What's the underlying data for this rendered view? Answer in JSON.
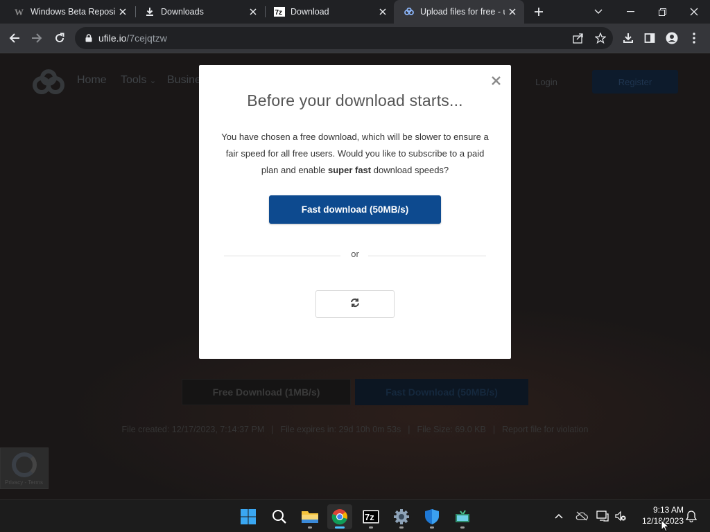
{
  "browser": {
    "tabs": [
      {
        "title": "Windows Beta Reposito",
        "icon": "wordpress-icon",
        "active": false
      },
      {
        "title": "Downloads",
        "icon": "download-icon",
        "active": false
      },
      {
        "title": "Download",
        "icon": "7zip-icon",
        "active": false
      },
      {
        "title": "Upload files for free - u",
        "icon": "ufile-icon",
        "active": true
      }
    ],
    "url_host": "ufile.io",
    "url_path": "/7cejqtzw"
  },
  "site": {
    "nav": [
      "Home",
      "Tools",
      "Busine"
    ],
    "login_label": "Login",
    "register_label": "Register",
    "free_download_label": "Free Download (1MB/s)",
    "fast_download_label": "Fast Download (50MB/s)",
    "meta": {
      "created": "File created: 12/17/2023, 7:14:37 PM",
      "expires": "File expires in: 29d 10h 0m 53s",
      "size": "File Size: 69.0 KB",
      "report": "Report file for violation"
    },
    "recaptcha_text": "Privacy - Terms"
  },
  "modal": {
    "title": "Before your download starts...",
    "body_part1": "You have chosen a free download, which will be slower to ensure a fair speed for all free users. Would you like to subscribe to a paid plan and enable ",
    "body_bold": "super fast",
    "body_part2": " download speeds?",
    "fast_button": "Fast download (50MB/s)",
    "or_label": "or",
    "close_icon": "close-icon",
    "spinner_icon": "refresh-icon"
  },
  "taskbar": {
    "apps": [
      "start-icon",
      "search-icon",
      "file-explorer-icon",
      "chrome-icon",
      "7zip-icon",
      "settings-icon",
      "windows-security-icon",
      "app-icon"
    ],
    "time": "9:13 AM",
    "date": "12/18/2023"
  },
  "colors": {
    "accent": "#0d4a8f",
    "chrome_dark": "#202124",
    "chrome_toolbar": "#35363a",
    "taskbar_active": "#4cc2ff"
  }
}
